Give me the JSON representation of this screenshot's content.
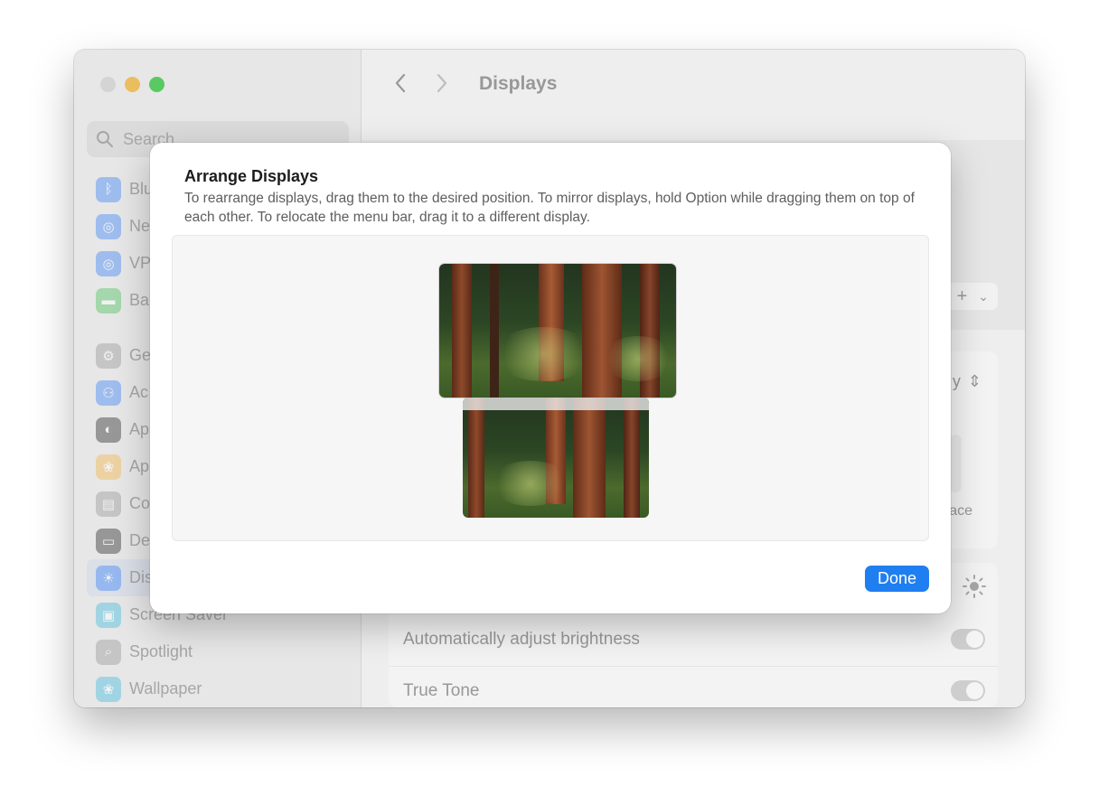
{
  "window": {
    "traffic_lights": [
      "close",
      "minimize",
      "maximize"
    ],
    "search": {
      "placeholder": "Search"
    },
    "sidebar": {
      "items": [
        {
          "label": "Blu",
          "icon": "bluetooth-icon",
          "color": "#2d7cf6"
        },
        {
          "label": "Ne",
          "icon": "globe-icon",
          "color": "#2d7cf6"
        },
        {
          "label": "VP",
          "icon": "vpn-globe-icon",
          "color": "#2d7cf6"
        },
        {
          "label": "Ba",
          "icon": "battery-icon",
          "color": "#3dbd4f"
        },
        {
          "label": "Ge",
          "icon": "gear-icon",
          "color": "#8e8e93"
        },
        {
          "label": "Ac",
          "icon": "accessibility-icon",
          "color": "#2d7cf6"
        },
        {
          "label": "Ap",
          "icon": "appearance-icon",
          "color": "#1c1c1e"
        },
        {
          "label": "Ap",
          "icon": "apple-intelligence-icon",
          "color": "#f2b13b"
        },
        {
          "label": "Co",
          "icon": "control-center-icon",
          "color": "#8e8e93"
        },
        {
          "label": "De",
          "icon": "desktop-dock-icon",
          "color": "#1c1c1e"
        },
        {
          "label": "Dis",
          "icon": "displays-sun-icon",
          "color": "#2d7cf6",
          "selected": true
        },
        {
          "label": "Screen Saver",
          "icon": "screen-saver-icon",
          "color": "#35b6d9"
        },
        {
          "label": "Spotlight",
          "icon": "magnifier-icon",
          "color": "#8e8e93"
        },
        {
          "label": "Wallpaper",
          "icon": "flower-icon",
          "color": "#35b6d9"
        }
      ]
    },
    "main": {
      "back_icon": "chevron-left-icon",
      "forward_icon": "chevron-right-icon",
      "title": "Displays",
      "fragments": {
        "popup_trailing": "y",
        "arrangement_label_trailing": "ace"
      },
      "rows": [
        {
          "label": "Automatically adjust brightness",
          "toggle": true
        },
        {
          "label": "True Tone",
          "toggle": true
        }
      ]
    }
  },
  "sheet": {
    "title": "Arrange Displays",
    "description": "To rearrange displays, drag them to the desired position. To mirror displays, hold Option while dragging them on top of each other. To relocate the menu bar, drag it to a different display.",
    "displays": [
      {
        "name": "primary-display",
        "has_menu_bar": false
      },
      {
        "name": "secondary-display",
        "has_menu_bar": true
      }
    ],
    "done_label": "Done",
    "accent": "#1f7ff0"
  }
}
